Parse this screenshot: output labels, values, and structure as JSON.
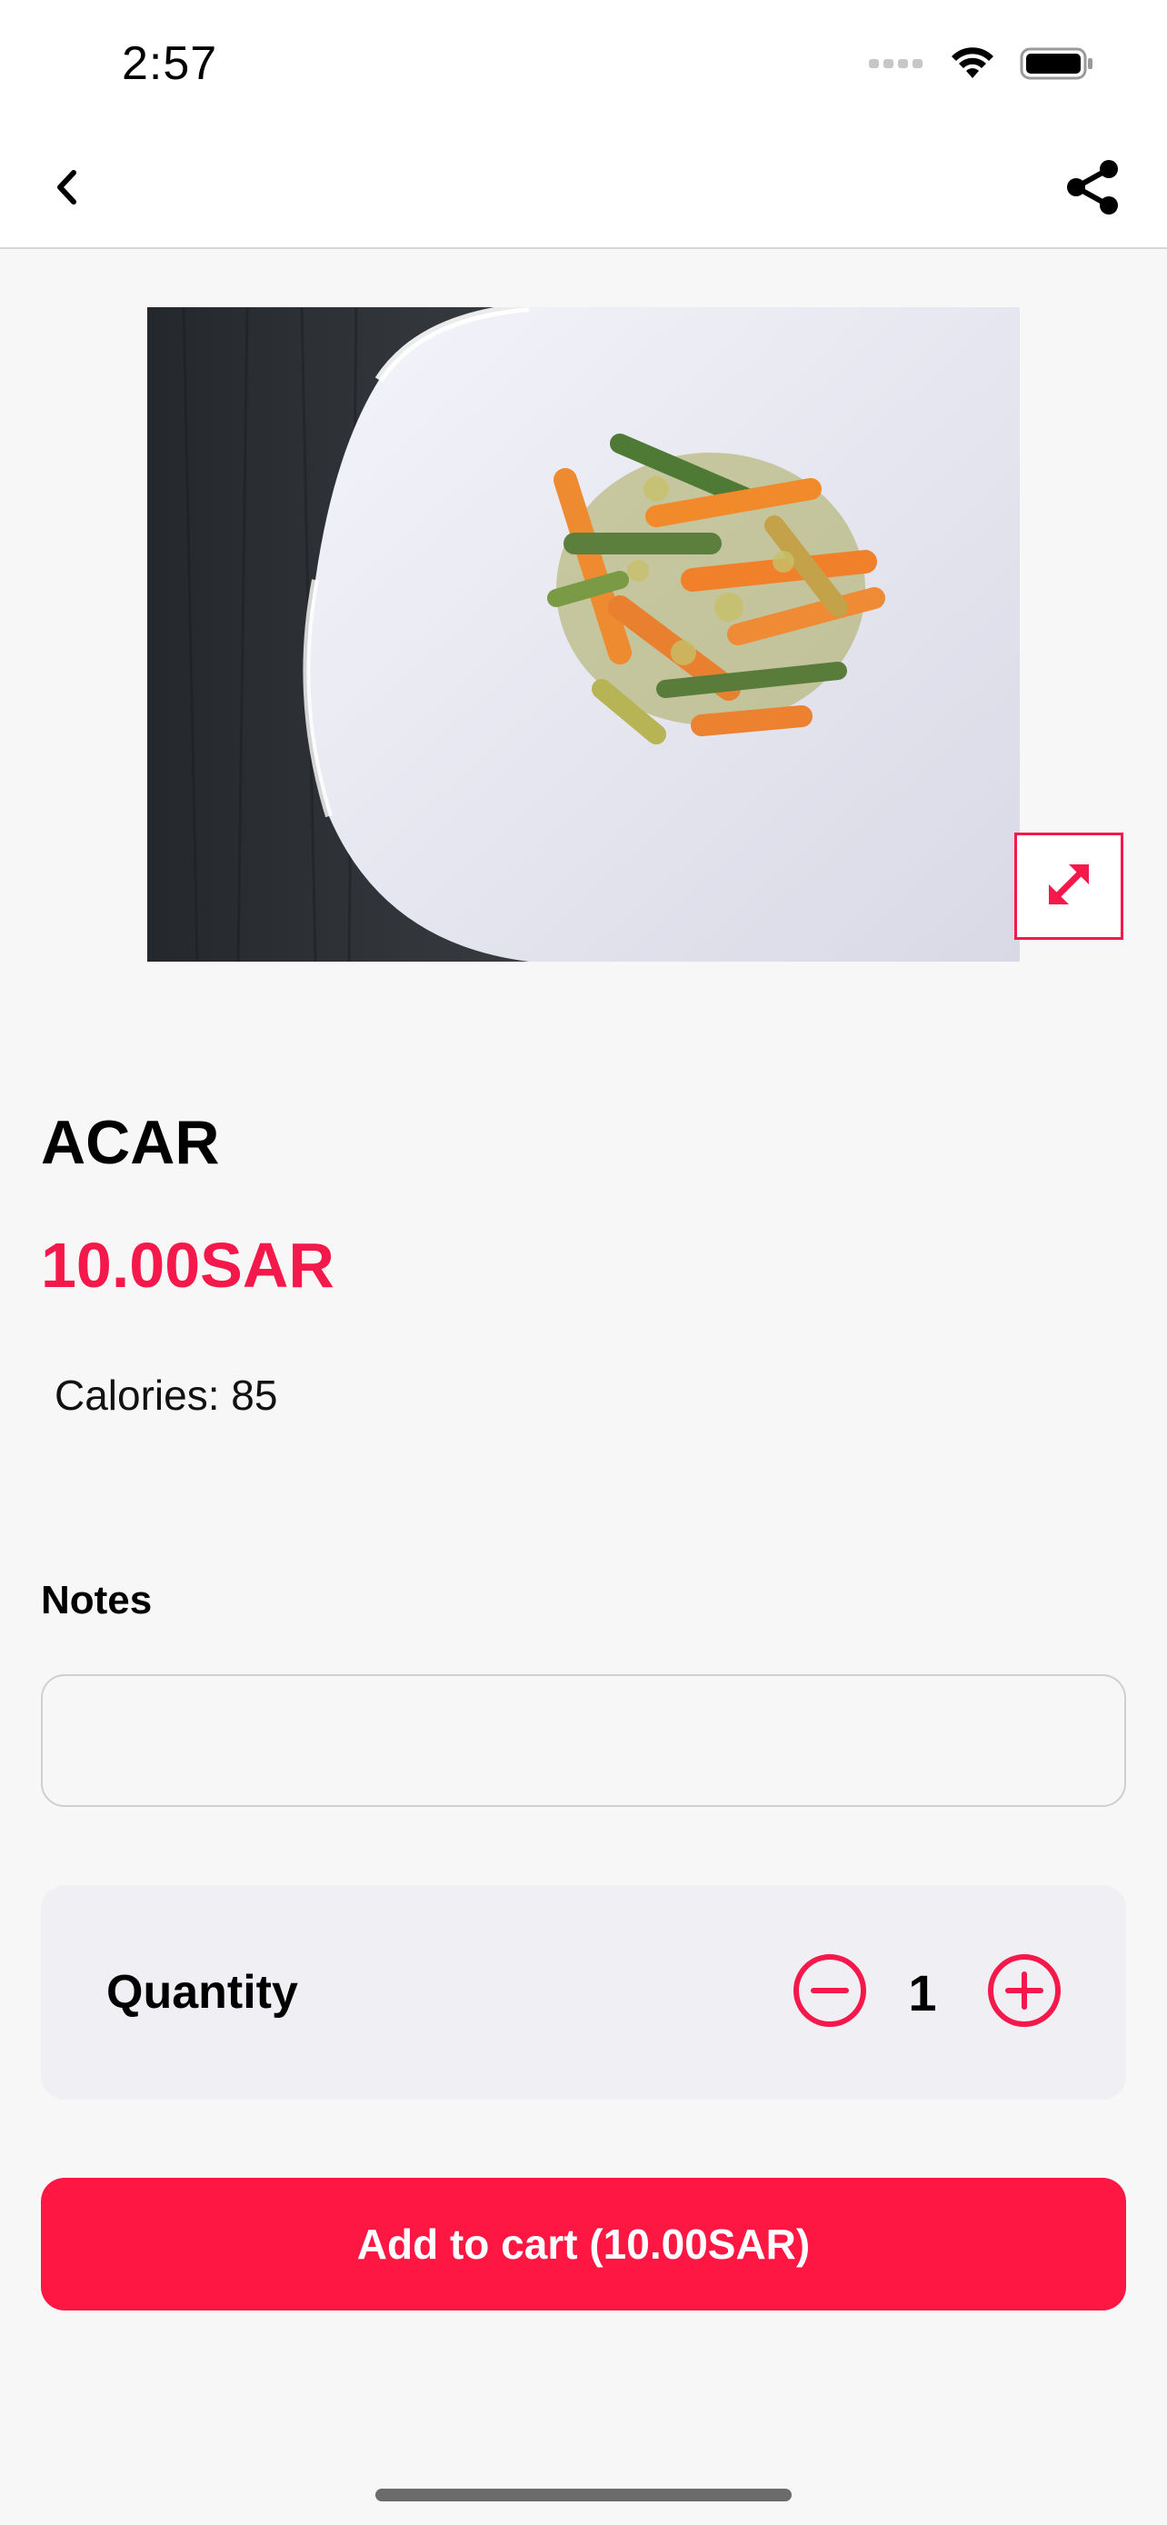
{
  "status_bar": {
    "time": "2:57"
  },
  "product": {
    "title": "ACAR",
    "price": "10.00SAR",
    "calories_label": "Calories:",
    "calories_value": "85"
  },
  "notes": {
    "label": "Notes",
    "value": "",
    "placeholder": ""
  },
  "quantity": {
    "label": "Quantity",
    "value": "1"
  },
  "cart": {
    "button_label": "Add to cart (10.00SAR)"
  },
  "colors": {
    "accent": "#f4194a",
    "button": "#ff1744",
    "card": "#f0eff4",
    "background": "#f7f7f7"
  }
}
